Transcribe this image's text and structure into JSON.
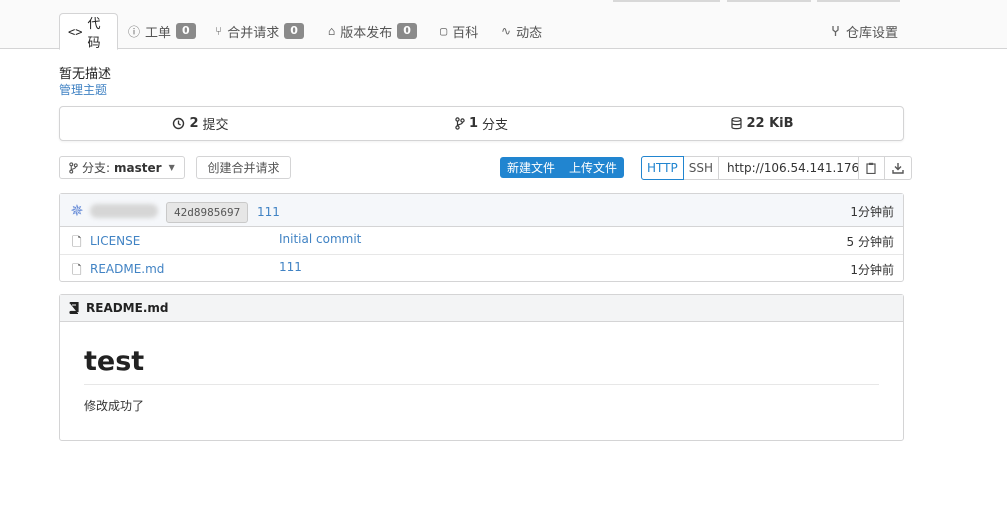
{
  "tabs": [
    {
      "icon": "<>",
      "label": "代码",
      "active": true
    },
    {
      "icon": "ⓘ",
      "label": "工单",
      "count": "0"
    },
    {
      "icon": "⑂",
      "label": "合并请求",
      "count": "0"
    },
    {
      "icon": "⌂",
      "label": "版本发布",
      "count": "0"
    },
    {
      "icon": "▢",
      "label": "百科"
    },
    {
      "icon": "∿",
      "label": "动态"
    }
  ],
  "settings_label": "仓库设置",
  "description": "暂无描述",
  "manage_topics": "管理主题",
  "stats": {
    "commits_num": "2",
    "commits_label": "提交",
    "branches_num": "1",
    "branches_label": "分支",
    "size": "22 KiB"
  },
  "toolbar": {
    "branch_prefix": "分支:",
    "branch_name": "master",
    "new_pr": "创建合并请求",
    "new_file": "新建文件",
    "upload_file": "上传文件",
    "http": "HTTP",
    "ssh": "SSH",
    "clone_url": "http://106.54.141.176"
  },
  "latest_commit": {
    "sha": "42d8985697",
    "message": "111",
    "time": "1分钟前"
  },
  "files": [
    {
      "name": "LICENSE",
      "message": "Initial commit",
      "time": "5 分钟前"
    },
    {
      "name": "README.md",
      "message": "111",
      "time": "1分钟前"
    }
  ],
  "readme": {
    "filename": "README.md",
    "heading": "test",
    "paragraph": "修改成功了"
  }
}
